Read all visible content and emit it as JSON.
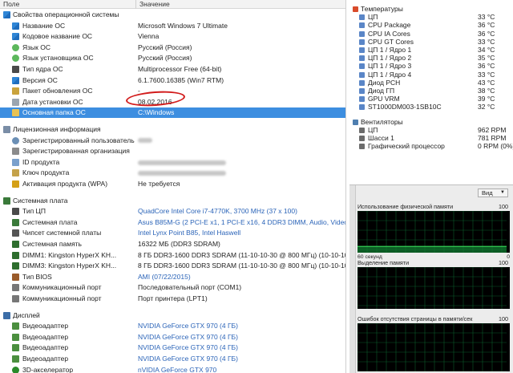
{
  "left": {
    "header": {
      "col_field": "Поле",
      "col_value": "Значение"
    },
    "os_section": "Свойства операционной системы",
    "os_rows": [
      {
        "name": "Название ОС",
        "value": "Microsoft Windows 7 Ultimate",
        "icon": "windows-icon"
      },
      {
        "name": "Кодовое название ОС",
        "value": "Vienna",
        "icon": "windows-icon"
      },
      {
        "name": "Язык ОС",
        "value": "Русский (Россия)",
        "icon": "globe-icon"
      },
      {
        "name": "Язык установщика ОС",
        "value": "Русский (Россия)",
        "icon": "globe-icon"
      },
      {
        "name": "Тип ядра ОС",
        "value": "Multiprocessor Free (64-bit)",
        "icon": "cpu-icon"
      },
      {
        "name": "Версия ОС",
        "value": "6.1.7600.16385 (Win7 RTM)",
        "icon": "windows-icon"
      },
      {
        "name": "Пакет обновления ОС",
        "value": "-",
        "icon": "package-icon"
      },
      {
        "name": "Дата установки ОС",
        "value": "08.02.2016",
        "icon": "calendar-icon"
      },
      {
        "name": "Основная папка ОС",
        "value": "C:\\Windows",
        "icon": "folder-icon"
      }
    ],
    "license_section": "Лицензионная информация",
    "license_rows": [
      {
        "name": "Зарегистрированный пользователь",
        "value": "",
        "icon": "user-icon"
      },
      {
        "name": "Зарегистрированная организация",
        "value": "",
        "icon": "organization-icon"
      },
      {
        "name": "ID продукта",
        "value": "",
        "icon": "id-icon"
      },
      {
        "name": "Ключ продукта",
        "value": "",
        "icon": "key-icon"
      },
      {
        "name": "Активация продукта (WPA)",
        "value": "Не требуется",
        "icon": "activation-key-icon"
      }
    ],
    "board_section": "Системная плата",
    "board_rows": [
      {
        "name": "Тип ЦП",
        "value": "QuadCore Intel Core i7-4770K, 3700 MHz (37 x 100)",
        "link": true,
        "icon": "cpu-icon"
      },
      {
        "name": "Системная плата",
        "value": "Asus B85M-G  (2 PCI-E x1, 1 PCI-E x16, 4 DDR3 DIMM, Audio, Video, Gigabit LAN)",
        "link": true,
        "icon": "motherboard-icon"
      },
      {
        "name": "Чипсет системной платы",
        "value": "Intel Lynx Point B85, Intel Haswell",
        "link": true,
        "icon": "chipset-icon"
      },
      {
        "name": "Системная память",
        "value": "16322 МБ  (DDR3 SDRAM)",
        "link": false,
        "icon": "memory-icon"
      },
      {
        "name": "DIMM1: Kingston HyperX KH...",
        "value": "8 ГБ DDR3-1600 DDR3 SDRAM  (11-10-10-30 @ 800 МГц)  (10-10-10-30 @ 800 МГц)",
        "link": false,
        "icon": "memory-icon"
      },
      {
        "name": "DIMM3: Kingston HyperX KH...",
        "value": "8 ГБ DDR3-1600 DDR3 SDRAM  (11-10-10-30 @ 800 МГц)  (10-10-10-30 @ 800 МГц)",
        "link": false,
        "icon": "memory-icon"
      },
      {
        "name": "Тип BIOS",
        "value": "AMI (07/22/2015)",
        "link": true,
        "icon": "bios-icon"
      },
      {
        "name": "Коммуникационный порт",
        "value": "Последовательный порт (COM1)",
        "link": false,
        "icon": "port-icon"
      },
      {
        "name": "Коммуникационный порт",
        "value": "Порт принтера (LPT1)",
        "link": false,
        "icon": "port-icon"
      }
    ],
    "display_section": "Дисплей",
    "display_rows": [
      {
        "name": "Видеоадаптер",
        "value": "NVIDIA GeForce GTX 970  (4 ГБ)",
        "icon": "gpu-icon"
      },
      {
        "name": "Видеоадаптер",
        "value": "NVIDIA GeForce GTX 970  (4 ГБ)",
        "icon": "gpu-icon"
      },
      {
        "name": "Видеоадаптер",
        "value": "NVIDIA GeForce GTX 970  (4 ГБ)",
        "icon": "gpu-icon"
      },
      {
        "name": "Видеоадаптер",
        "value": "NVIDIA GeForce GTX 970  (4 ГБ)",
        "icon": "gpu-icon"
      },
      {
        "name": "3D-акселератор",
        "value": "nVIDIA GeForce GTX 970",
        "icon": "3d-accelerator-icon"
      }
    ]
  },
  "sensors": {
    "temp_header": "Температуры",
    "temps": [
      {
        "name": "ЦП",
        "value": "33 °C"
      },
      {
        "name": "CPU Package",
        "value": "36 °C"
      },
      {
        "name": "CPU IA Cores",
        "value": "36 °C"
      },
      {
        "name": "CPU GT Cores",
        "value": "33 °C"
      },
      {
        "name": "ЦП 1 / Ядро 1",
        "value": "34 °C"
      },
      {
        "name": "ЦП 1 / Ядро 2",
        "value": "35 °C"
      },
      {
        "name": "ЦП 1 / Ядро 3",
        "value": "36 °C"
      },
      {
        "name": "ЦП 1 / Ядро 4",
        "value": "33 °C"
      },
      {
        "name": "Диод PCH",
        "value": "43 °C"
      },
      {
        "name": "Диод ГП",
        "value": "38 °C"
      },
      {
        "name": "GPU VRM",
        "value": "39 °C"
      },
      {
        "name": "ST1000DM003-1SB10C",
        "value": "32 °C"
      }
    ],
    "fan_header": "Вентиляторы",
    "fans": [
      {
        "name": "ЦП",
        "value": "962 RPM"
      },
      {
        "name": "Шасси 1",
        "value": "781 RPM"
      },
      {
        "name": "Графический процессор",
        "value": "0 RPM  (0%)"
      }
    ]
  },
  "perf": {
    "view_label": "Вид",
    "graphs": [
      {
        "title": "Использование физической памяти",
        "max": "100",
        "foot_left": "60 секунд",
        "foot_right": "0",
        "level": 0.15
      },
      {
        "title": "Выделение памяти",
        "max": "100",
        "foot_left": "",
        "foot_right": "",
        "level": 0.0
      },
      {
        "title": "Ошибок отсутствия страницы в памяти/сек",
        "max": "100",
        "foot_left": "",
        "foot_right": "",
        "level": 0.0
      }
    ]
  }
}
